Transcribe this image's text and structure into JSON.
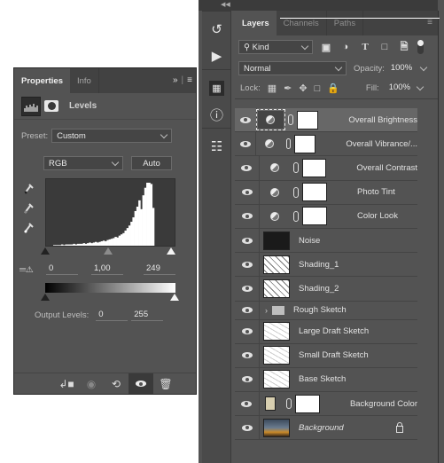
{
  "properties_panel": {
    "tabs": [
      {
        "label": "Properties",
        "active": true
      },
      {
        "label": "Info",
        "active": false
      }
    ],
    "header_title": "Levels",
    "preset_label": "Preset:",
    "preset_value": "Custom",
    "channel_value": "RGB",
    "auto_label": "Auto",
    "input_levels": {
      "black": "0",
      "gamma": "1,00",
      "white": "249"
    },
    "output_levels_label": "Output Levels:",
    "output_levels": {
      "black": "0",
      "white": "255"
    },
    "histogram": [
      1,
      1,
      1,
      1,
      2,
      1,
      2,
      2,
      2,
      2,
      3,
      2,
      3,
      3,
      3,
      4,
      3,
      4,
      5,
      4,
      5,
      6,
      5,
      6,
      7,
      8,
      7,
      9,
      10,
      11,
      12,
      14,
      13,
      16,
      18,
      20,
      24,
      28,
      32,
      38,
      45,
      55,
      62,
      72,
      58,
      80,
      92,
      100,
      100,
      98,
      60
    ]
  },
  "layers_panel": {
    "tabs": [
      {
        "label": "Layers",
        "active": true
      },
      {
        "label": "Channels",
        "active": false
      },
      {
        "label": "Paths",
        "active": false
      }
    ],
    "filter_kind": "Kind",
    "blend_mode": "Normal",
    "opacity_label": "Opacity:",
    "opacity_value": "100%",
    "lock_label": "Lock:",
    "fill_label": "Fill:",
    "fill_value": "100%",
    "layers": [
      {
        "name": "Overall Brightness",
        "type": "adjustment",
        "selected": true
      },
      {
        "name": "Overall Vibrance/...",
        "type": "adjustment"
      },
      {
        "name": "Overall Contrast",
        "type": "adjustment"
      },
      {
        "name": "Photo Tint",
        "type": "adjustment"
      },
      {
        "name": "Color Look",
        "type": "adjustment"
      },
      {
        "name": "Noise",
        "type": "pixel"
      },
      {
        "name": "Shading_1",
        "type": "pixel"
      },
      {
        "name": "Shading_2",
        "type": "pixel"
      },
      {
        "name": "Rough Sketch",
        "type": "group"
      },
      {
        "name": "Large Draft Sketch",
        "type": "pixel"
      },
      {
        "name": "Small Draft Sketch",
        "type": "pixel"
      },
      {
        "name": "Base Sketch",
        "type": "pixel"
      },
      {
        "name": "Background Color",
        "type": "fill"
      },
      {
        "name": "Background",
        "type": "background",
        "locked": true
      }
    ]
  }
}
